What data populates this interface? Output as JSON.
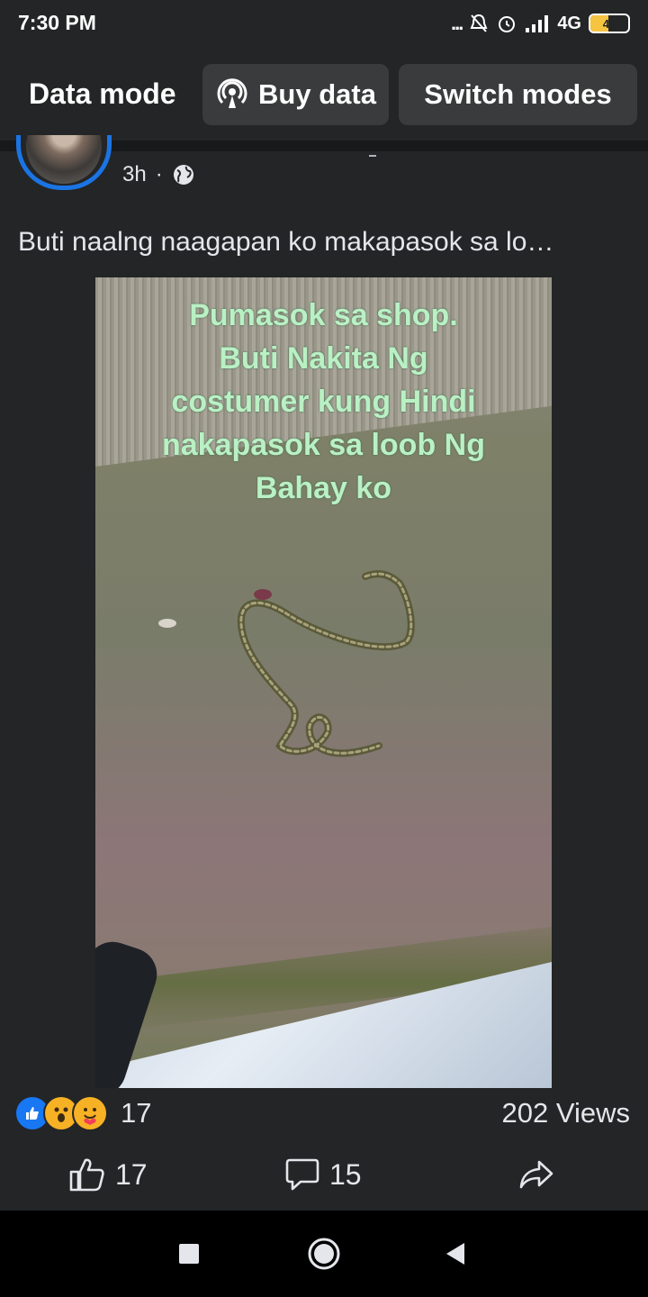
{
  "status_bar": {
    "time": "7:30 PM",
    "dots": "...",
    "network": "4G",
    "battery_level": "48",
    "battery_fraction": 0.48
  },
  "data_mode": {
    "title": "Data mode",
    "buy_data_label": "Buy data",
    "switch_modes_label": "Switch modes"
  },
  "post": {
    "time_ago": "3h",
    "separator": "·",
    "text": "Buti naalng naagapan ko makapasok sa lo…",
    "image_caption": [
      "Pumasok sa shop.",
      "Buti Nakita Ng",
      "costumer kung Hindi",
      "nakapasok sa loob Ng",
      "Bahay ko"
    ],
    "reaction_icons": [
      "like-reaction",
      "wow-reaction",
      "care-reaction"
    ],
    "reaction_count": "17",
    "views": "202 Views",
    "like_count": "17",
    "comment_count": "15"
  },
  "colors": {
    "background": "#242526",
    "accent": "#1b74e4",
    "caption": "#b9f0c4"
  }
}
